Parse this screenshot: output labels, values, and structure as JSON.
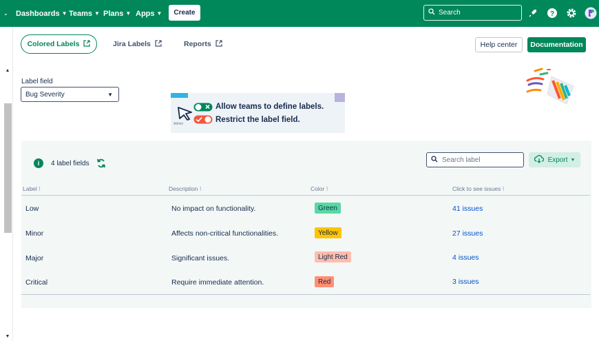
{
  "nav": {
    "left_chevron": "⌄",
    "items": [
      {
        "label": "Dashboards"
      },
      {
        "label": "Teams"
      },
      {
        "label": "Plans"
      },
      {
        "label": "Apps"
      }
    ],
    "create_label": "Create",
    "search_placeholder": "Search"
  },
  "tabs": [
    {
      "label": "Colored Labels",
      "active": true
    },
    {
      "label": "Jira Labels",
      "active": false
    },
    {
      "label": "Reports",
      "active": false
    }
  ],
  "buttons": {
    "help": "Help center",
    "documentation": "Documentation"
  },
  "label_field": {
    "caption": "Label field",
    "value": "Bug Severity"
  },
  "banner": {
    "line1": "Allow teams to define labels.",
    "line2": "Restrict the label field.",
    "admin_tag": "Admin"
  },
  "table_panel": {
    "count_text": "4 label fields",
    "search_placeholder": "Search label",
    "export_label": "Export",
    "headers": {
      "label": "Label",
      "description": "Description",
      "color": "Color",
      "issues": "Click to see issues"
    },
    "rows": [
      {
        "label": "Low",
        "description": "No impact on functionality.",
        "color_name": "Green",
        "color_hex": "#57d9a3",
        "issues": "41 issues"
      },
      {
        "label": "Minor",
        "description": "Affects non-critical functionalities.",
        "color_name": "Yellow",
        "color_hex": "#ffc400",
        "issues": "27 issues"
      },
      {
        "label": "Major",
        "description": "Significant issues.",
        "color_name": "Light Red",
        "color_hex": "#ffbdad",
        "issues": "4 issues"
      },
      {
        "label": "Critical",
        "description": "Require immediate attention.",
        "color_name": "Red",
        "color_hex": "#ff8f73",
        "issues": "3 issues"
      }
    ]
  },
  "colors": {
    "brand": "#00875a",
    "link": "#0052cc"
  }
}
